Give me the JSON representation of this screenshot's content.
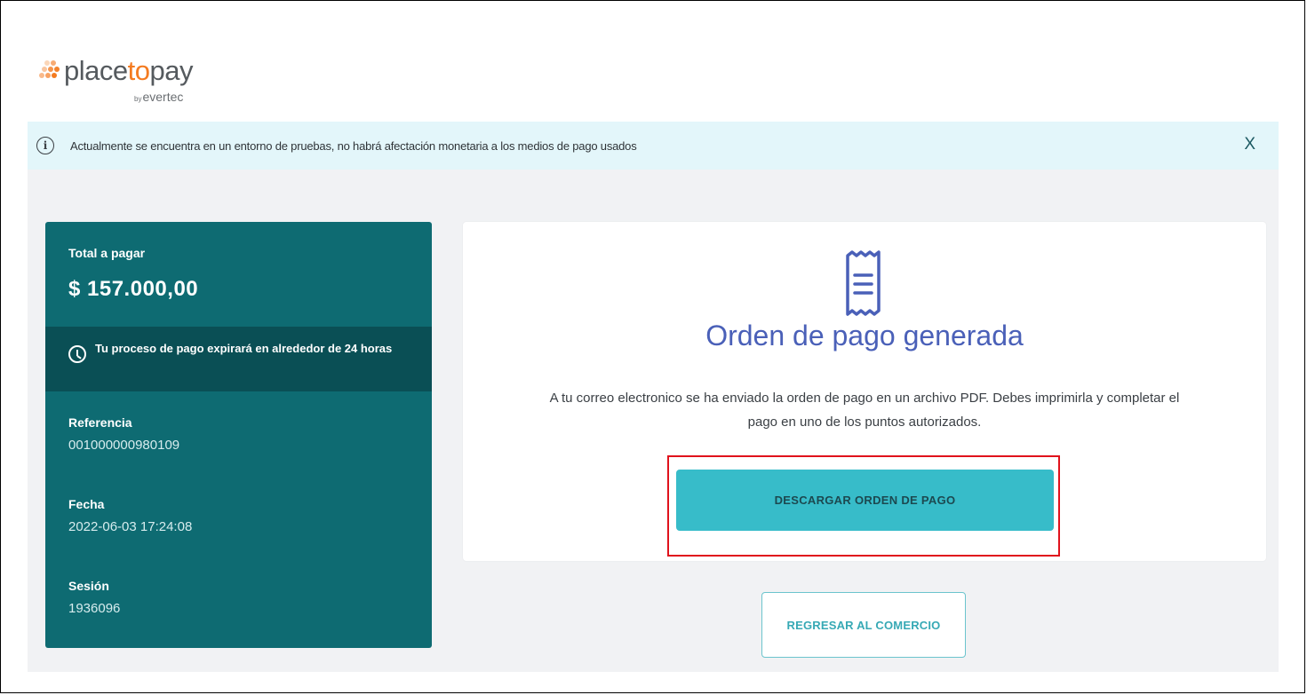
{
  "brand": {
    "name_part1": "place",
    "name_highlight": "to",
    "name_part2": "pay",
    "by": "by",
    "sub": "evertec",
    "accent_color": "#f47b20"
  },
  "notice": {
    "icon": "info-icon",
    "text": "Actualmente se encuentra en un entorno de pruebas, no habrá afectación monetaria a los medios de pago usados",
    "close": "X"
  },
  "summary": {
    "total_label": "Total a pagar",
    "total_amount": "$ 157.000,00",
    "expiry_text": "Tu proceso de pago expirará en alrededor de 24 horas",
    "reference_label": "Referencia",
    "reference_value": "001000000980109",
    "date_label": "Fecha",
    "date_value": "2022-06-03 17:24:08",
    "session_label": "Sesión",
    "session_value": "1936096",
    "panel_color": "#0e6b72"
  },
  "card": {
    "icon": "receipt-icon",
    "title": "Orden de pago generada",
    "description": "A tu correo electronico se ha enviado la orden de pago en un archivo PDF. Debes imprimirla y completar el pago en uno de los puntos autorizados.",
    "download_button": "DESCARGAR ORDEN DE PAGO",
    "title_color": "#4a60b8"
  },
  "actions": {
    "return_button": "REGRESAR AL COMERCIO",
    "button_color": "#37bcc9"
  }
}
